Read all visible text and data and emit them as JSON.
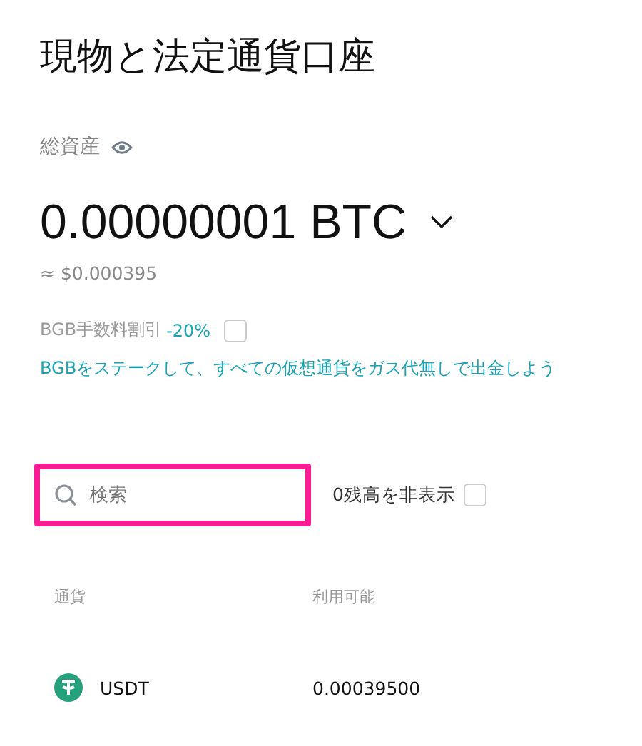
{
  "title": "現物と法定通貨口座",
  "total_assets": {
    "label": "総資産",
    "amount": "0.00000001 BTC",
    "approx": "≈ $0.000395"
  },
  "fee_discount": {
    "label": "BGB手数料割引",
    "discount": "-20%",
    "checked": false
  },
  "promo_link": "BGBをステークして、すべての仮想通貨をガス代無しで出金しよう",
  "search": {
    "placeholder": "検索",
    "highlighted": true
  },
  "hide_zero": {
    "label": "0残高を非表示",
    "checked": false
  },
  "table": {
    "columns": [
      "通貨",
      "利用可能"
    ],
    "rows": [
      {
        "currency": "USDT",
        "available": "0.00039500"
      }
    ]
  }
}
